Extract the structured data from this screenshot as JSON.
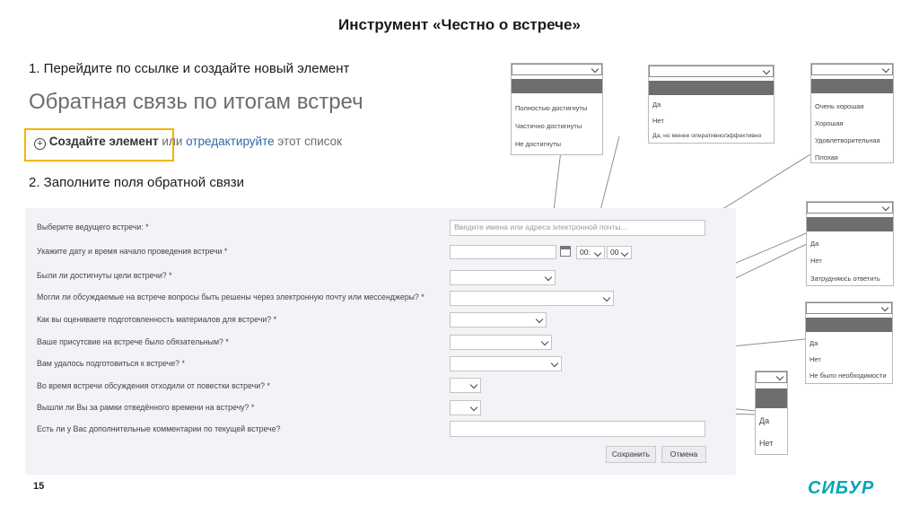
{
  "slide": {
    "title": "Инструмент «Честно о встрече»",
    "page_number": "15",
    "logo_text": "СИБУР"
  },
  "steps": [
    {
      "text": "1. Перейдите по ссылке и создайте новый элемент"
    },
    {
      "text": "2. Заполните поля обратной связи"
    }
  ],
  "list": {
    "title": "Обратная связь по итогам встреч",
    "create_label": "Создайте элемент",
    "or_text": "или",
    "edit_label": "отредактируйте",
    "tail_text": "этот список"
  },
  "form": {
    "fields": [
      {
        "label": "Выберите ведущего встречи: *",
        "placeholder": "Введите имена или адреса электронной почты..."
      },
      {
        "label": "Укажите дату и время начало проведения встречи *"
      },
      {
        "label": "Были ли достигнуты цели встречи? *"
      },
      {
        "label": "Могли ли обсуждаемые на встрече вопросы быть решены через электронную почту или мессенджеры? *"
      },
      {
        "label": "Как вы оцениваете подготовленность материалов для встречи? *"
      },
      {
        "label": "Ваше присутсвие на встрече было обязательным? *"
      },
      {
        "label": "Вам удалось подготовиться к встрече? *"
      },
      {
        "label": "Во время встречи обсуждения отходили от повестки встречи? *"
      },
      {
        "label": "Вышли ли Вы за рамки отведённого времени на встречу? *"
      },
      {
        "label": "Есть ли у Вас дополнительные комментарии по текущей встрече?"
      }
    ],
    "hour_value": "00:",
    "minute_value": "00",
    "save_label": "Сохранить",
    "cancel_label": "Отмена"
  },
  "dropdowns": {
    "goals": [
      "Полностью достигнуты",
      "Частично достигнуты",
      "Не достигнуты"
    ],
    "email": [
      "Да",
      "Нет",
      "Да, но менее оперативно/эффективно"
    ],
    "materials": [
      "Очень хорошая",
      "Хорошая",
      "Удовлетворительная",
      "Плохая"
    ],
    "presence": [
      "Да",
      "Нет",
      "Затрудняюсь ответить"
    ],
    "prepared": [
      "Да",
      "Нет",
      "Не было необходимости"
    ],
    "yesno": [
      "Да",
      "Нет"
    ]
  },
  "icons": {
    "plus": "plus-circle-icon",
    "calendar": "calendar-icon",
    "chevron": "chevron-down-icon"
  },
  "colors": {
    "accent_highlight": "#f5b400",
    "link": "#2f6aa8",
    "brand": "#00a6b8",
    "selected_option": "#6e6e6e"
  }
}
